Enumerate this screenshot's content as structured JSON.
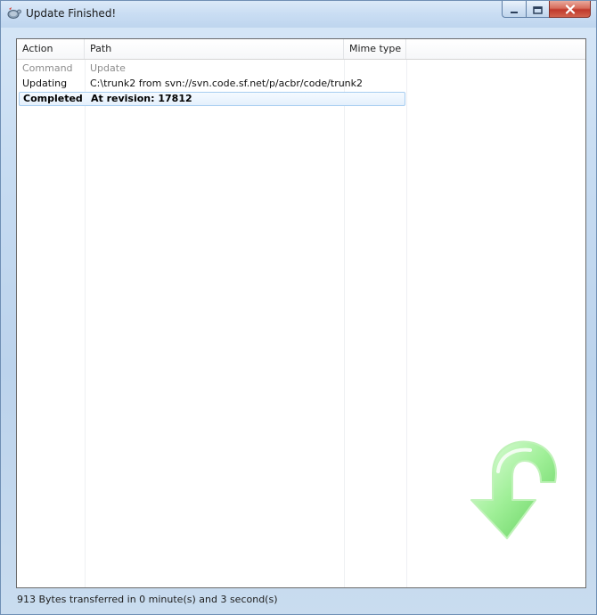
{
  "window": {
    "title": "Update Finished!",
    "title_icon": "tortoise-svn-icon",
    "caption_buttons": [
      "minimize-icon",
      "maximize-icon",
      "close-icon"
    ]
  },
  "list": {
    "columns": [
      "Action",
      "Path",
      "Mime type"
    ],
    "rows": [
      {
        "action": "Command",
        "path": "Update",
        "mime": "",
        "style": "muted"
      },
      {
        "action": "Updating",
        "path": "C:\\trunk2 from svn://svn.code.sf.net/p/acbr/code/trunk2",
        "mime": "",
        "style": "normal"
      },
      {
        "action": "Completed",
        "path": "At revision: 17812",
        "mime": "",
        "style": "bold-selected"
      }
    ]
  },
  "decoration": {
    "arrow_icon": "green-curved-down-arrow-icon",
    "arrow_color": "#7ee07a"
  },
  "status": {
    "text": "913 Bytes transferred in 0 minute(s) and 3 second(s)"
  },
  "colors": {
    "selection_border": "#a7cdf0",
    "close_button": "#c0392b"
  }
}
